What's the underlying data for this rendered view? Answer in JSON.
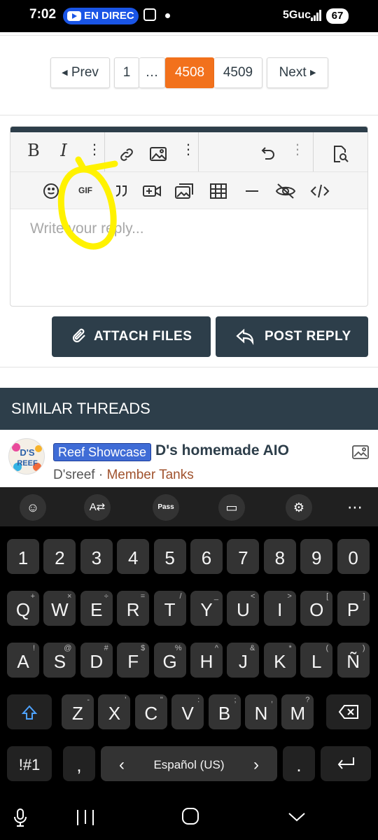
{
  "status_bar": {
    "time": "7:02",
    "live_label": "EN DIREC",
    "network": "5Guc",
    "battery": "67"
  },
  "pagination": {
    "prev": "Prev",
    "pages": [
      "1",
      "…",
      "4508",
      "4509"
    ],
    "current": "4508",
    "next": "Next"
  },
  "editor": {
    "toolbar_row1": [
      "bold",
      "italic",
      "more-text",
      "link",
      "image",
      "more-insert",
      "undo",
      "more",
      "preview"
    ],
    "bold_label": "B",
    "italic_label": "I",
    "gif_label": "GIF",
    "placeholder": "Write your reply..."
  },
  "actions": {
    "attach": "ATTACH FILES",
    "post": "POST REPLY"
  },
  "similar": {
    "header": "SIMILAR THREADS",
    "threads": [
      {
        "avatar_text": "D'S REEF",
        "tag": "Reef Showcase",
        "title": "D's homemade AIO",
        "author": "D'sreef",
        "forum": "Member Tanks"
      }
    ]
  },
  "keyboard": {
    "tools": [
      "emoji-icon",
      "translate-icon",
      "pass-icon",
      "clipboard-icon",
      "gear-icon",
      "more-icon"
    ],
    "row_numbers": [
      "1",
      "2",
      "3",
      "4",
      "5",
      "6",
      "7",
      "8",
      "9",
      "0"
    ],
    "row_q": [
      {
        "k": "Q",
        "s": "+"
      },
      {
        "k": "W",
        "s": "×"
      },
      {
        "k": "E",
        "s": "÷"
      },
      {
        "k": "R",
        "s": "="
      },
      {
        "k": "T",
        "s": "/"
      },
      {
        "k": "Y",
        "s": "_"
      },
      {
        "k": "U",
        "s": "<"
      },
      {
        "k": "I",
        "s": ">"
      },
      {
        "k": "O",
        "s": "["
      },
      {
        "k": "P",
        "s": "]"
      }
    ],
    "row_a": [
      {
        "k": "A",
        "s": "!"
      },
      {
        "k": "S",
        "s": "@"
      },
      {
        "k": "D",
        "s": "#"
      },
      {
        "k": "F",
        "s": "$"
      },
      {
        "k": "G",
        "s": "%"
      },
      {
        "k": "H",
        "s": "^"
      },
      {
        "k": "J",
        "s": "&"
      },
      {
        "k": "K",
        "s": "*"
      },
      {
        "k": "L",
        "s": "("
      },
      {
        "k": "Ñ",
        "s": ")"
      }
    ],
    "row_z": [
      {
        "k": "Z",
        "s": "-"
      },
      {
        "k": "X",
        "s": "'"
      },
      {
        "k": "C",
        "s": "\""
      },
      {
        "k": "V",
        "s": ":"
      },
      {
        "k": "B",
        "s": ";"
      },
      {
        "k": "N",
        "s": ","
      },
      {
        "k": "M",
        "s": "?"
      }
    ],
    "symbols": "!#1",
    "comma": ",",
    "space": "Español (US)",
    "period": ".",
    "left_arrow": "‹",
    "right_arrow": "›"
  }
}
